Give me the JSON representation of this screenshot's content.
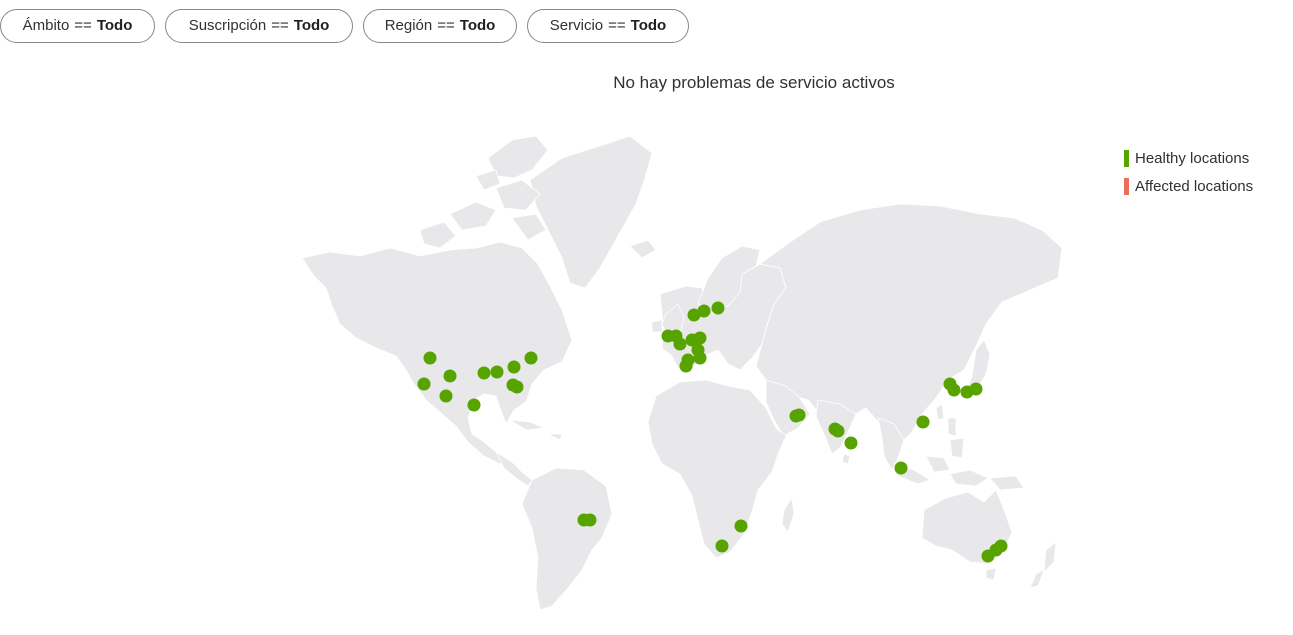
{
  "filters": [
    {
      "key": "Ámbito",
      "op": "==",
      "value": "Todo"
    },
    {
      "key": "Suscripción",
      "op": "==",
      "value": "Todo"
    },
    {
      "key": "Región",
      "op": "==",
      "value": "Todo"
    },
    {
      "key": "Servicio",
      "op": "==",
      "value": "Todo"
    }
  ],
  "status_title": "No hay problemas de servicio activos",
  "legend": {
    "healthy": {
      "label": "Healthy locations",
      "color": "#57a300"
    },
    "affected": {
      "label": "Affected locations",
      "color": "#e8705a"
    }
  },
  "map": {
    "land_color": "#e8e8ea",
    "healthy_marker_count": 48,
    "affected_marker_count": 0
  }
}
